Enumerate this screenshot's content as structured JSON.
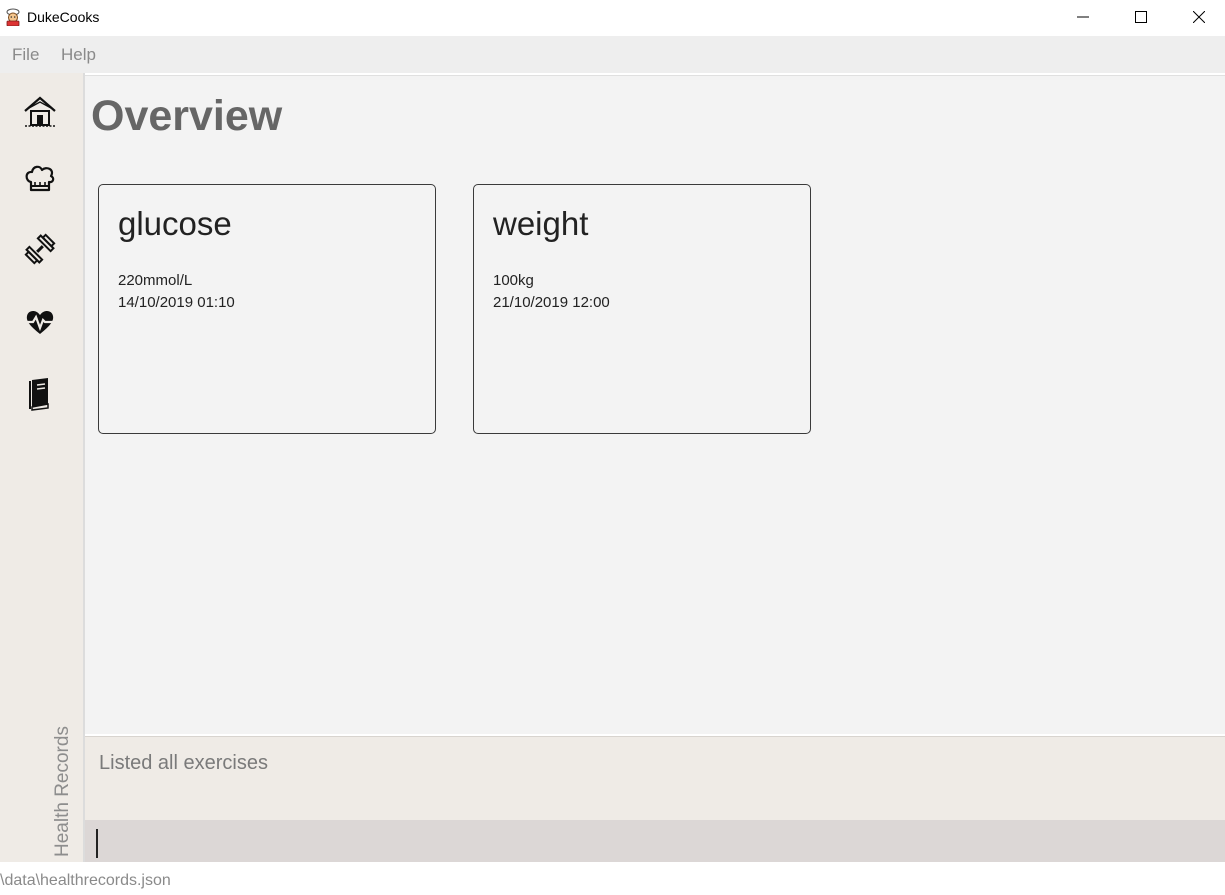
{
  "window": {
    "title": "DukeCooks",
    "app_icon": "chef-avatar-icon"
  },
  "menu": {
    "items": [
      "File",
      "Help"
    ]
  },
  "sidebar": {
    "items": [
      {
        "icon": "home-icon"
      },
      {
        "icon": "chef-hat-icon"
      },
      {
        "icon": "dumbbell-icon"
      },
      {
        "icon": "heartbeat-icon"
      },
      {
        "icon": "book-icon"
      }
    ],
    "section_label": "Health Records"
  },
  "main": {
    "title": "Overview",
    "cards": [
      {
        "title": "glucose",
        "value": "220mmol/L",
        "timestamp": "14/10/2019 01:10"
      },
      {
        "title": "weight",
        "value": "100kg",
        "timestamp": "21/10/2019 12:00"
      }
    ]
  },
  "result": {
    "message": "Listed all exercises"
  },
  "command": {
    "value": ""
  },
  "status": {
    "path": "\\data\\healthrecords.json"
  }
}
